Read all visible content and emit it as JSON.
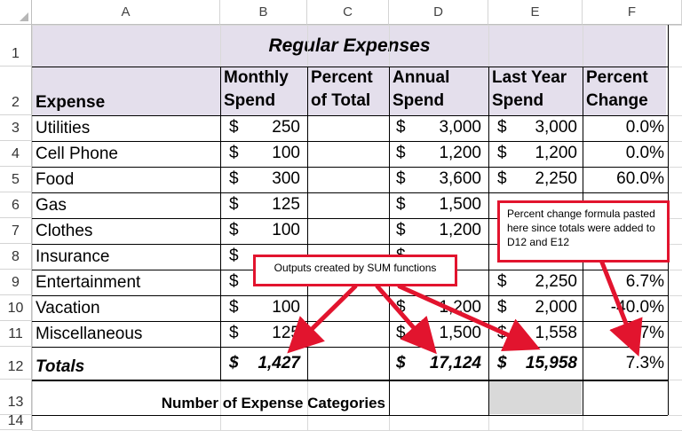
{
  "columns": [
    "A",
    "B",
    "C",
    "D",
    "E",
    "F"
  ],
  "rows": [
    "1",
    "2",
    "3",
    "4",
    "5",
    "6",
    "7",
    "8",
    "9",
    "10",
    "11",
    "12",
    "13",
    "14"
  ],
  "title": "Regular Expenses",
  "headers": {
    "expense": "Expense",
    "monthly": [
      "Monthly",
      "Spend"
    ],
    "percent_total": [
      "Percent",
      "of Total"
    ],
    "annual": [
      "Annual",
      "Spend"
    ],
    "last_year": [
      "Last Year",
      "Spend"
    ],
    "percent_change": [
      "Percent",
      "Change"
    ]
  },
  "currency": "$",
  "data_rows": [
    {
      "expense": "Utilities",
      "monthly": "250",
      "annual": "3,000",
      "last_year": "3,000",
      "change": "0.0%"
    },
    {
      "expense": "Cell Phone",
      "monthly": "100",
      "annual": "1,200",
      "last_year": "1,200",
      "change": "0.0%"
    },
    {
      "expense": "Food",
      "monthly": "300",
      "annual": "3,600",
      "last_year": "2,250",
      "change": "60.0%"
    },
    {
      "expense": "Gas",
      "monthly": "125",
      "annual": "1,500",
      "last_year": "",
      "change": ""
    },
    {
      "expense": "Clothes",
      "monthly": "100",
      "annual": "1,200",
      "last_year": "",
      "change": ""
    },
    {
      "expense": "Insurance",
      "monthly": "",
      "annual": "",
      "last_year": "",
      "change": ""
    },
    {
      "expense": "Entertainment",
      "monthly": "",
      "annual": "",
      "last_year": "2,250",
      "change": "6.7%"
    },
    {
      "expense": "Vacation",
      "monthly": "100",
      "annual": "1,200",
      "last_year": "2,000",
      "change": "-40.0%"
    },
    {
      "expense": "Miscellaneous",
      "monthly": "125",
      "annual": "1,500",
      "last_year": "1,558",
      "change": "-3.7%"
    }
  ],
  "totals": {
    "label": "Totals",
    "monthly": "1,427",
    "annual": "17,124",
    "last_year": "15,958",
    "change": "7.3%"
  },
  "row13_label": "Number of Expense Categories",
  "callouts": {
    "sum": "Outputs created by SUM functions",
    "percent": "Percent change formula pasted here since totals were added to D12 and E12"
  },
  "colors": {
    "title_fill": "#e4dfec",
    "callout_border": "#e2142e",
    "arrow": "#e2142e",
    "gray_fill": "#d9d9d9"
  }
}
